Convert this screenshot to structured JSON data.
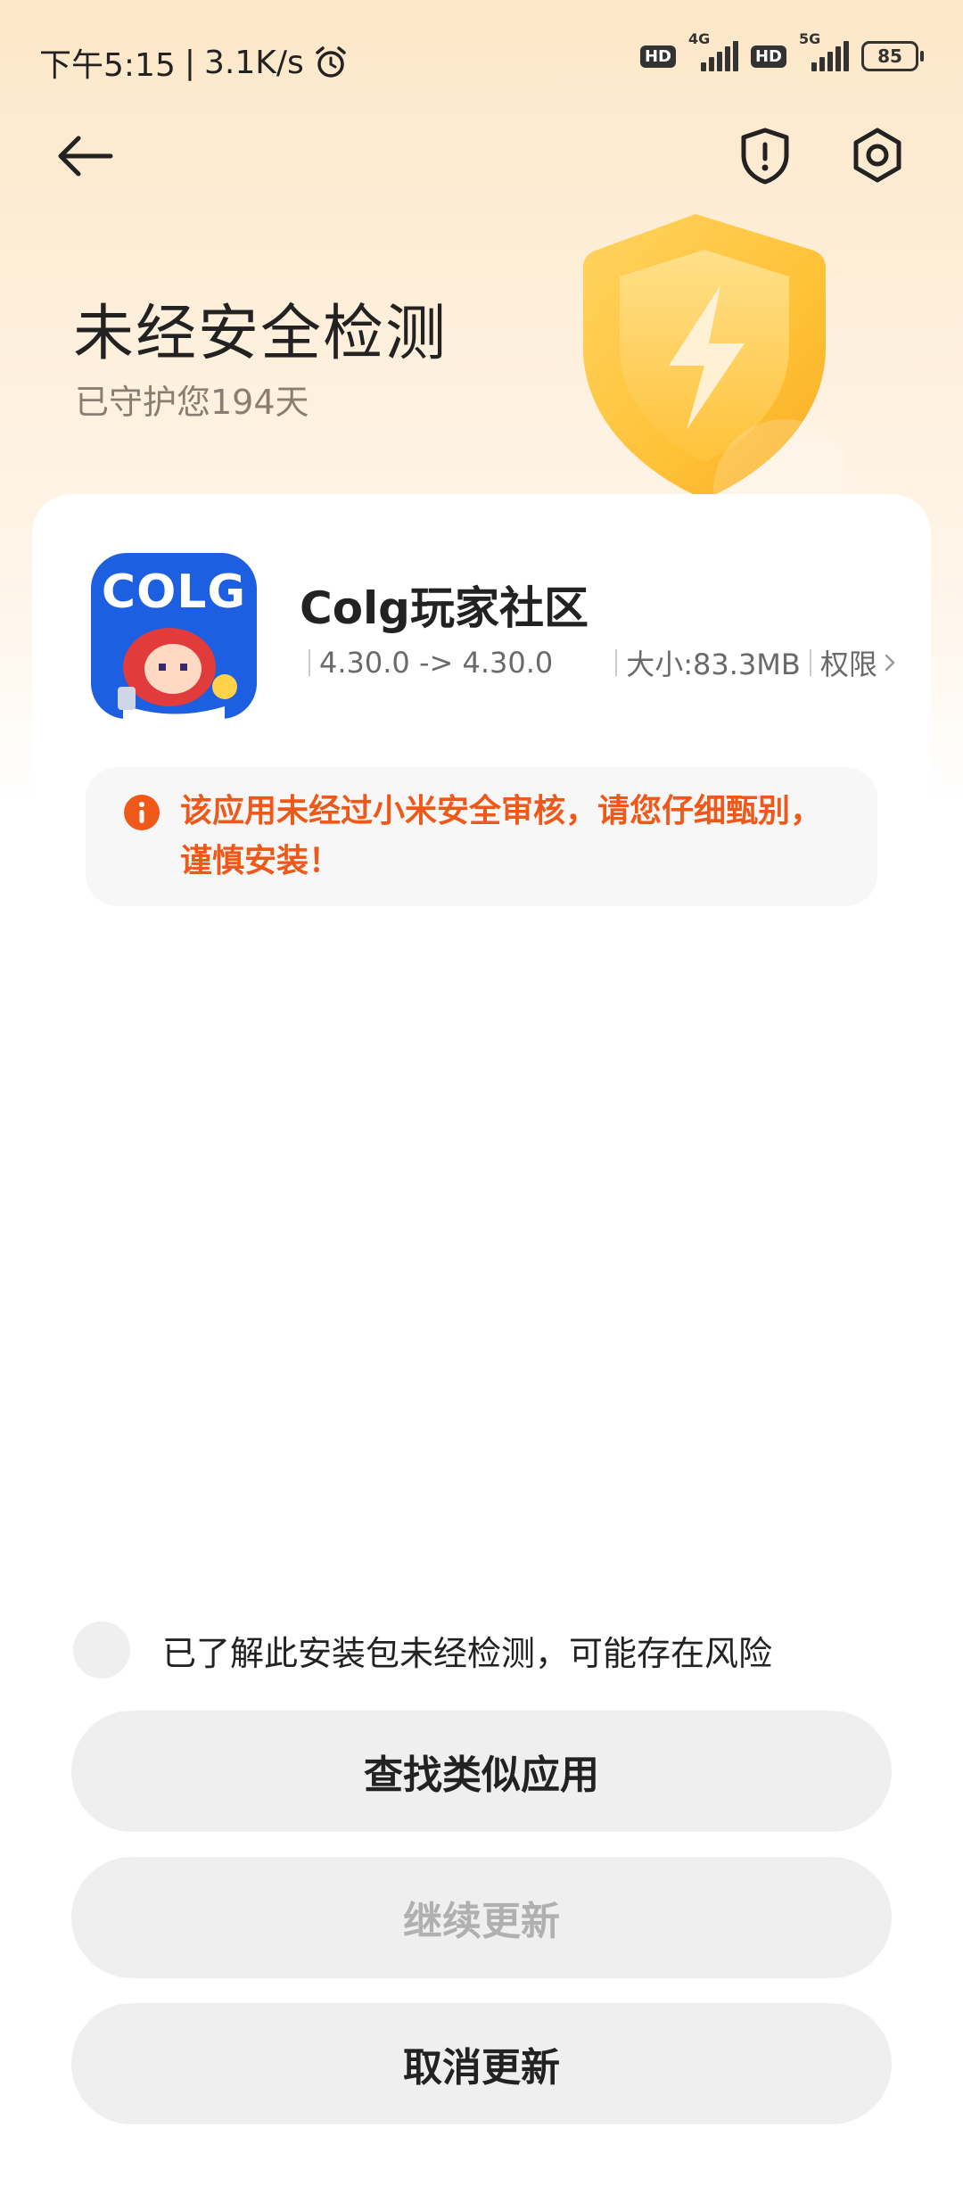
{
  "status_bar": {
    "time": "下午5:15",
    "divider": "|",
    "speed": "3.1K/s",
    "sim1": {
      "hd": "HD",
      "network": "4G"
    },
    "sim2": {
      "hd": "HD",
      "network": "5G"
    },
    "battery": "85",
    "icons": [
      "alarm-icon",
      "signal-icon",
      "battery-icon"
    ]
  },
  "nav": {
    "icons": [
      "back-arrow-icon",
      "shield-alert-icon",
      "settings-icon"
    ]
  },
  "header": {
    "title": "未经安全检测",
    "protected_days": "已守护您194天"
  },
  "app": {
    "icon_text": "COLG",
    "name": "Colg玩家社区",
    "version": "4.30.0 -> 4.30.0",
    "size": "大小:83.3MB",
    "permissions": "权限"
  },
  "warning": {
    "text": "该应用未经过小米安全审核，请您仔细甄别，谨慎安装！",
    "color": "#f0581a"
  },
  "actions": {
    "acknowledge": "已了解此安装包未经检测，可能存在风险",
    "find_similar": "查找类似应用",
    "continue_update": "继续更新",
    "cancel_update": "取消更新"
  }
}
